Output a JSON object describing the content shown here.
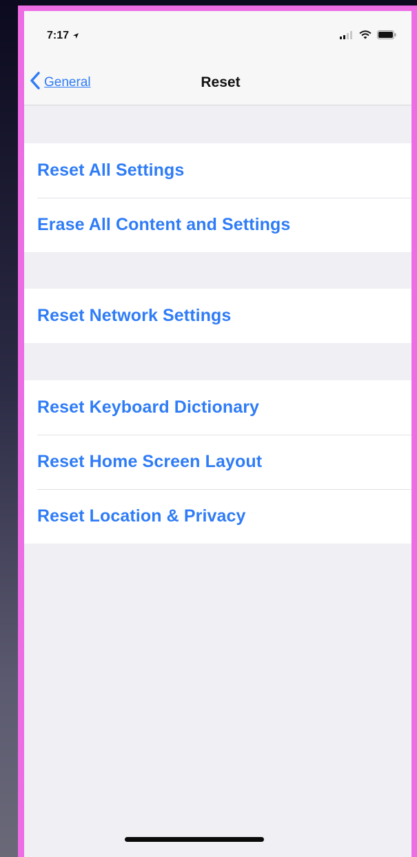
{
  "status_bar": {
    "time": "7:17"
  },
  "nav": {
    "back_label": "General",
    "title": "Reset"
  },
  "groups": [
    {
      "items": [
        {
          "label": "Reset All Settings"
        },
        {
          "label": "Erase All Content and Settings"
        }
      ]
    },
    {
      "items": [
        {
          "label": "Reset Network Settings"
        }
      ]
    },
    {
      "items": [
        {
          "label": "Reset Keyboard Dictionary"
        },
        {
          "label": "Reset Home Screen Layout"
        },
        {
          "label": "Reset Location & Privacy"
        }
      ]
    }
  ],
  "colors": {
    "accent": "#2f7cf6",
    "frame": "#ec6de4",
    "background": "#efeff4"
  },
  "icons": [
    "location-icon",
    "signal-icon",
    "wifi-icon",
    "battery-icon",
    "chevron-left-icon"
  ]
}
